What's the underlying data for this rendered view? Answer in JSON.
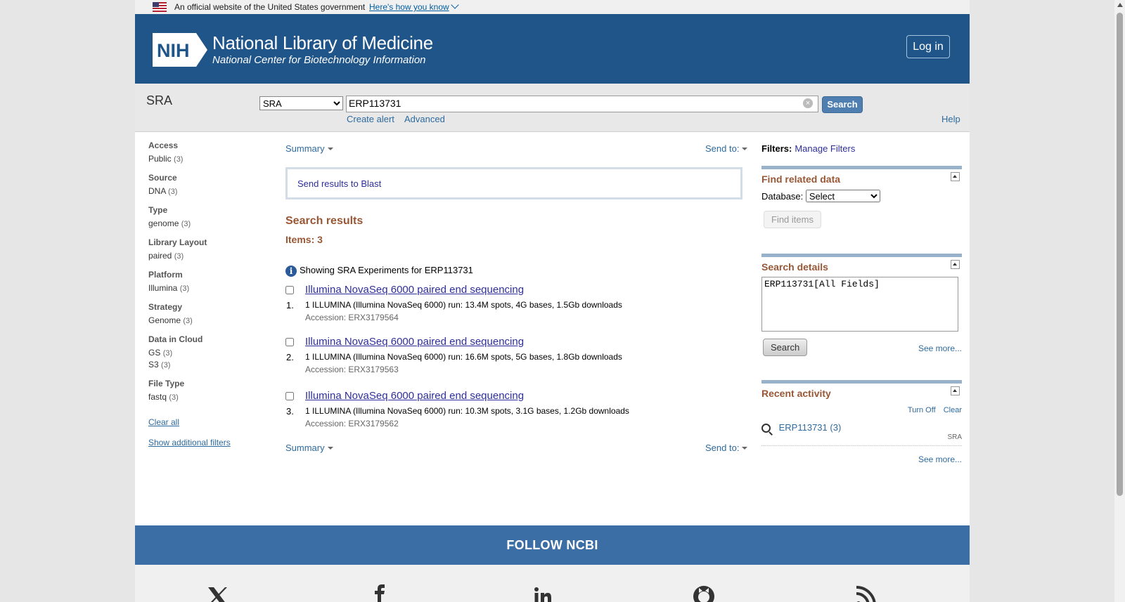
{
  "gov_banner": {
    "text": "An official website of the United States government",
    "link": "Here's how you know"
  },
  "header": {
    "logo_text": "NIH",
    "title": "National Library of Medicine",
    "subtitle": "National Center for Biotechnology Information",
    "login": "Log in"
  },
  "searchbar": {
    "db_name": "SRA",
    "db_selected": "SRA",
    "term": "ERP113731",
    "search_button": "Search",
    "create_alert": "Create alert",
    "advanced": "Advanced",
    "help": "Help"
  },
  "facets": {
    "groups": [
      {
        "label": "Access",
        "items": [
          {
            "name": "Public",
            "count": "(3)"
          }
        ]
      },
      {
        "label": "Source",
        "items": [
          {
            "name": "DNA",
            "count": "(3)"
          }
        ]
      },
      {
        "label": "Type",
        "items": [
          {
            "name": "genome",
            "count": "(3)"
          }
        ]
      },
      {
        "label": "Library Layout",
        "items": [
          {
            "name": "paired",
            "count": "(3)"
          }
        ]
      },
      {
        "label": "Platform",
        "items": [
          {
            "name": "Illumina",
            "count": "(3)"
          }
        ]
      },
      {
        "label": "Strategy",
        "items": [
          {
            "name": "Genome",
            "count": "(3)"
          }
        ]
      },
      {
        "label": "Data in Cloud",
        "items": [
          {
            "name": "GS",
            "count": "(3)"
          },
          {
            "name": "S3",
            "count": "(3)"
          }
        ]
      },
      {
        "label": "File Type",
        "items": [
          {
            "name": "fastq",
            "count": "(3)"
          }
        ]
      }
    ],
    "clear_all": "Clear all",
    "show_additional": "Show additional filters"
  },
  "results": {
    "summary_label": "Summary",
    "send_to_label": "Send to:",
    "blast_link": "Send results to Blast",
    "title": "Search results",
    "items_count": "Items: 3",
    "info_text": "Showing SRA Experiments for ERP113731",
    "list": [
      {
        "num": "1.",
        "title": "Illumina NovaSeq 6000 paired end sequencing",
        "desc": "1 ILLUMINA (Illumina NovaSeq 6000) run: 13.4M spots, 4G bases, 1.5Gb downloads",
        "accession": "Accession: ERX3179564"
      },
      {
        "num": "2.",
        "title": "Illumina NovaSeq 6000 paired end sequencing",
        "desc": "1 ILLUMINA (Illumina NovaSeq 6000) run: 16.6M spots, 5G bases, 1.8Gb downloads",
        "accession": "Accession: ERX3179563"
      },
      {
        "num": "3.",
        "title": "Illumina NovaSeq 6000 paired end sequencing",
        "desc": "1 ILLUMINA (Illumina NovaSeq 6000) run: 10.3M spots, 3.1G bases, 1.2Gb downloads",
        "accession": "Accession: ERX3179562"
      }
    ]
  },
  "sidebar": {
    "filters_label": "Filters:",
    "manage_filters": "Manage Filters",
    "find_related": {
      "title": "Find related data",
      "database_label": "Database:",
      "database_selected": "Select",
      "find_button": "Find items"
    },
    "search_details": {
      "title": "Search details",
      "query": "ERP113731[All Fields]",
      "search_button": "Search",
      "see_more": "See more..."
    },
    "recent_activity": {
      "title": "Recent activity",
      "turn_off": "Turn Off",
      "clear": "Clear",
      "item": "ERP113731 (3)",
      "item_db": "SRA",
      "see_more": "See more..."
    }
  },
  "footer": {
    "follow": "FOLLOW NCBI"
  },
  "colors": {
    "header_blue": "#20558a",
    "footer_blue": "#3b6ea5",
    "heading_brown": "#985735",
    "link_blue": "#2e2e9a"
  }
}
